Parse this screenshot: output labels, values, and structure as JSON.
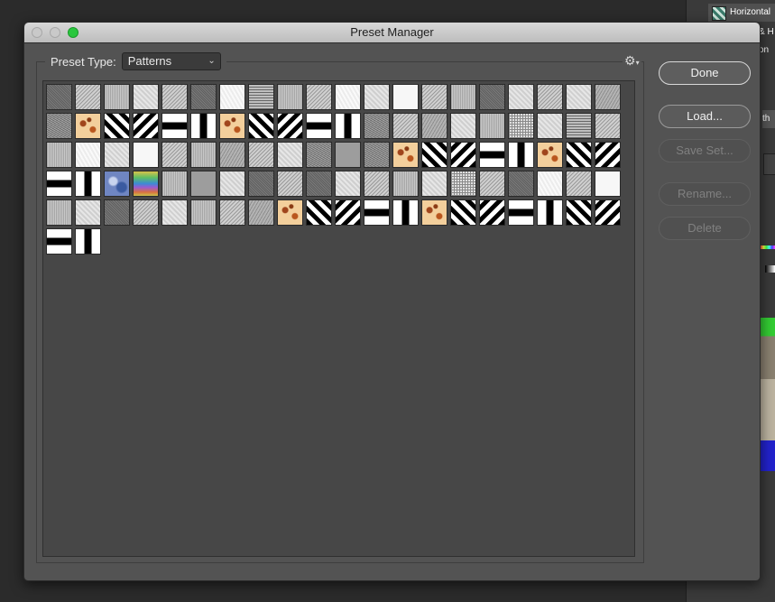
{
  "background": {
    "panel_item_label": "Horizontal",
    "fragment_1": "& H",
    "fragment_2": "on",
    "fragment_3": "th"
  },
  "dialog": {
    "title": "Preset Manager",
    "preset_type_label": "Preset Type:",
    "preset_type_value": "Patterns",
    "buttons": {
      "done": "Done",
      "load": "Load...",
      "save_set": "Save Set...",
      "rename": "Rename...",
      "delete": "Delete"
    }
  },
  "swatches": [
    "noise1",
    "noise2",
    "noise3",
    "light",
    "noise2",
    "noise1",
    "white",
    "grid",
    "noise3",
    "noise2",
    "white",
    "light",
    "plain",
    "noise2",
    "noise3",
    "noise1",
    "light",
    "noise2",
    "light",
    "mid",
    "dark",
    "rust",
    "diag-r",
    "diag-l",
    "hstripe",
    "vstripe",
    "rust",
    "diag-r",
    "diag-l",
    "hstripe",
    "vstripe",
    "dark",
    "noise2",
    "mid",
    "light",
    "noise3",
    "cross",
    "light",
    "grid",
    "noise2",
    "noise3",
    "white",
    "light",
    "plain",
    "noise2",
    "noise3",
    "mid",
    "noise2",
    "light",
    "dark",
    "gray",
    "dark",
    "rust",
    "diag-r",
    "diag-l",
    "hstripe",
    "vstripe",
    "rust",
    "diag-r",
    "diag-l",
    "hstripe",
    "vstripe",
    "blue",
    "rainbow",
    "noise3",
    "gray",
    "light",
    "noise1",
    "noise2",
    "noise1",
    "light",
    "noise2",
    "noise3",
    "light",
    "cross",
    "noise2",
    "noise1",
    "white",
    "noise2",
    "plain",
    "noise3",
    "light",
    "noise1",
    "noise2",
    "light",
    "noise3",
    "noise2",
    "mid",
    "rust",
    "diag-r",
    "diag-l",
    "hstripe",
    "vstripe",
    "rust",
    "diag-r",
    "diag-l",
    "hstripe",
    "vstripe",
    "diag-r",
    "diag-l",
    "hstripe",
    "vstripe"
  ]
}
